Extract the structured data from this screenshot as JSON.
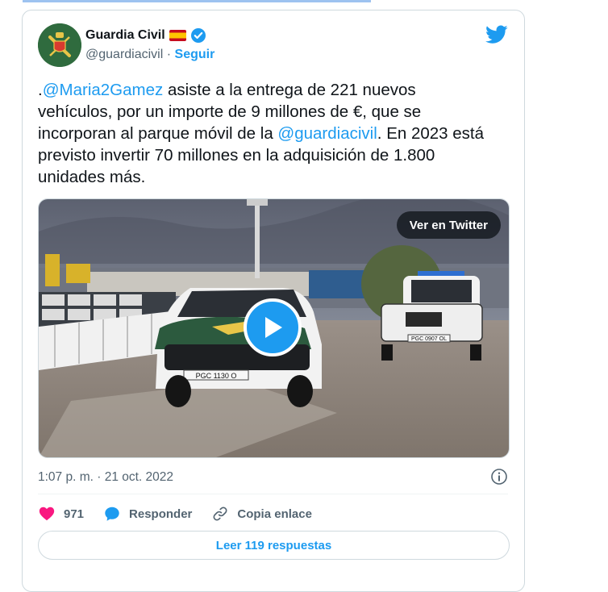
{
  "author": {
    "name": "Guardia Civil",
    "handle": "@guardiacivil",
    "separator": "·",
    "follow_label": "Seguir"
  },
  "tweet": {
    "prefix": ".",
    "mention1": "@Maria2Gamez",
    "text1": " asiste a la entrega de 221 nuevos vehículos, por un importe de 9 millones de €, que se incorporan al parque móvil de la ",
    "mention2": "@guardiacivil",
    "text2": ". En 2023 está previsto invertir 70 millones en la adquisición de 1.800 unidades más."
  },
  "media": {
    "view_on_twitter": "Ver en Twitter",
    "plate1": "PGC 1130 O",
    "plate2": "PGC 0907 OL"
  },
  "timestamp": "1:07 p. m. · 21 oct. 2022",
  "actions": {
    "like_count": "971",
    "reply_label": "Responder",
    "copy_link_label": "Copia enlace"
  },
  "read_replies_label": "Leer 119 respuestas",
  "colors": {
    "accent": "#1d9bf0",
    "like": "#f91880",
    "text": "#0f1419",
    "muted": "#536471"
  }
}
